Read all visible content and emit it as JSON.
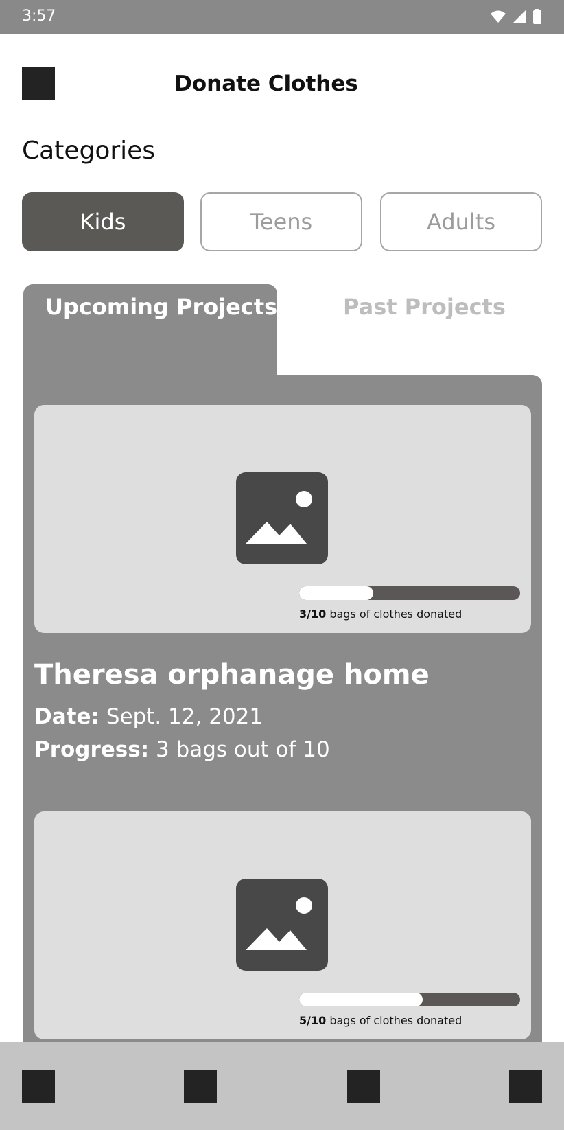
{
  "status_bar": {
    "time": "3:57",
    "icons": [
      "wifi-icon",
      "signal-icon",
      "battery-icon"
    ]
  },
  "header": {
    "menu_icon": "menu-square-icon",
    "title": "Donate Clothes"
  },
  "categories": {
    "heading": "Categories",
    "items": [
      {
        "label": "Kids",
        "selected": true
      },
      {
        "label": "Teens",
        "selected": false
      },
      {
        "label": "Adults",
        "selected": false
      }
    ]
  },
  "tabs": [
    {
      "label": "Upcoming Projects",
      "selected": true
    },
    {
      "label": "Past Projects",
      "selected": false
    }
  ],
  "projects": [
    {
      "image_icon": "image-placeholder-icon",
      "progress_fraction": 0.3,
      "progress_count": "3/10",
      "progress_caption": " bags of clothes donated",
      "name": "Theresa orphanage home",
      "date_label": "Date:",
      "date_value": " Sept. 12, 2021",
      "progress_label": "Progress:",
      "progress_value": " 3 bags out of 10"
    },
    {
      "image_icon": "image-placeholder-icon",
      "progress_fraction": 0.5,
      "progress_count": "5/10",
      "progress_caption": " bags of clothes donated"
    }
  ],
  "bottom_nav": {
    "icons": [
      "nav-item-1-icon",
      "nav-item-2-icon",
      "nav-item-3-icon",
      "nav-item-4-icon"
    ]
  },
  "colors": {
    "status_bar": "#898989",
    "selected_chip": "#5a5956",
    "panel": "#8b8b8b",
    "card": "#dedede",
    "progress_track": "#5c5757",
    "bottom_nav": "#c4c4c4"
  }
}
